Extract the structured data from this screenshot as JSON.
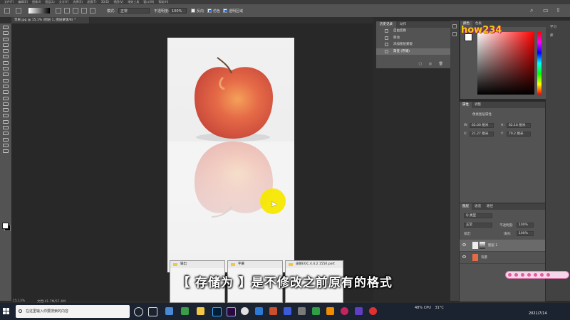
{
  "menu": {
    "items": [
      "文件(F)",
      "编辑(E)",
      "图像(I)",
      "图层(L)",
      "文字(Y)",
      "选择(S)",
      "滤镜(T)",
      "3D(D)",
      "视图(V)",
      "增效工具",
      "窗口(W)",
      "帮助(H)"
    ]
  },
  "options": {
    "mode_label": "模式:",
    "mode_value": "正常",
    "opacity_label": "不透明度:",
    "opacity_value": "100%",
    "reverse_label": "反向",
    "dither_label": "仿色",
    "transparency_label": "透明区域",
    "transparency_checked": true
  },
  "document": {
    "tab": "苹果.jpg @ 15.1% (图层 1, 图层蒙版/8) *",
    "zoom": "15.13%",
    "doc_info": "文档:41.7M/57.4M"
  },
  "history": {
    "tabs": [
      "历史记录",
      "动作"
    ],
    "items": [
      {
        "label": "自由变换",
        "selected": false
      },
      {
        "label": "移动",
        "selected": false
      },
      {
        "label": "添加图层蒙版",
        "selected": false
      },
      {
        "label": "渐变 (存储)",
        "selected": true
      }
    ],
    "footer": "▢ ◎ 🗑"
  },
  "color": {
    "tabs": [
      "颜色",
      "色板"
    ],
    "logo": "how234",
    "hue_color": "#ff0000"
  },
  "learn": {
    "items": [
      "学习",
      "库"
    ]
  },
  "properties": {
    "tabs": [
      "属性",
      "调整"
    ],
    "title": "像素图层属性",
    "w_label": "W:",
    "w_value": "62.00 厘米",
    "h_label": "H:",
    "h_value": "62.16 厘米",
    "x_label": "X:",
    "x_value": "21.27 厘米",
    "y_label": "Y:",
    "y_value": "79.2 厘米"
  },
  "layers": {
    "tabs": [
      "图层",
      "通道",
      "路径"
    ],
    "filter": "Q 类型",
    "blend": "正常",
    "opacity_label": "不透明度:",
    "opacity_value": "100%",
    "lock_label": "锁定:",
    "fill_label": "填充:",
    "fill_value": "100%",
    "rows": [
      {
        "name": "图层 1",
        "selected": true
      },
      {
        "name": "背景",
        "selected": false
      }
    ]
  },
  "explorer": [
    {
      "title": "输出"
    },
    {
      "title": "字幕"
    },
    {
      "title": "录屏EOC.4.4.2.1550.port"
    }
  ],
  "subtitle": "【 存储为 】是不修改之前原有的格式",
  "taskbar": {
    "search_placeholder": "在这里输入你要搜索的内容",
    "weather": "31°C",
    "tray_label": "CPU",
    "tray_value": "48%",
    "date": "2021/7/14"
  }
}
